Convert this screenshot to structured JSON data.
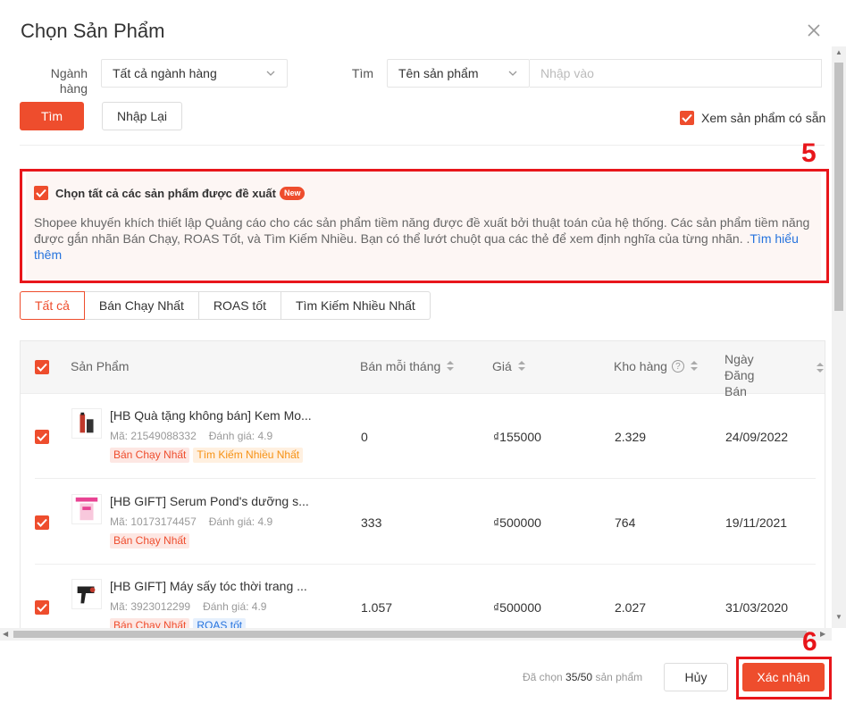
{
  "modal": {
    "title": "Chọn Sản Phẩm"
  },
  "filters": {
    "category_label": "Ngành hàng",
    "category_value": "Tất cả ngành hàng",
    "search_label": "Tìm",
    "search_type_value": "Tên sản phẩm",
    "search_placeholder": "Nhập vào",
    "search_button": "Tìm",
    "reset_button": "Nhập Lại",
    "available_only_label": "Xem sản phẩm có sẵn"
  },
  "suggest": {
    "select_all_label": "Chọn tất cả các sản phẩm được đề xuất",
    "new_badge": "New",
    "description": "Shopee khuyến khích thiết lập Quảng cáo cho các sản phẩm tiềm năng được đề xuất bởi thuật toán của hệ thống. Các sản phẩm tiềm năng được gắn nhãn Bán Chạy, ROAS Tốt, và Tìm Kiếm Nhiều. Bạn có thể lướt chuột qua các thẻ để xem định nghĩa của từng nhãn. Tìm hiểu thêm.",
    "learn_more": "Tìm hiểu thêm"
  },
  "annotations": {
    "step5": "5",
    "step6": "6"
  },
  "tabs": [
    "Tất cả",
    "Bán Chạy Nhất",
    "ROAS tốt",
    "Tìm Kiếm Nhiều Nhất"
  ],
  "table": {
    "headers": {
      "product": "Sản Phẩm",
      "monthly_sales": "Bán mỗi tháng",
      "price": "Giá",
      "stock": "Kho hàng",
      "listed_date": "Ngày Đăng Bán",
      "help_glyph": "?"
    },
    "rows": [
      {
        "name": "[HB Quà tặng không bán] Kem Mo...",
        "code": "Mã: 21549088332",
        "rating": "Đánh giá: 4.9",
        "tags": [
          "Bán Chạy Nhất",
          "Tìm Kiếm Nhiều Nhất"
        ],
        "sales": "0",
        "price": "₫155000",
        "stock": "2.329",
        "date": "24/09/2022"
      },
      {
        "name": "[HB GIFT] Serum Pond's dưỡng s...",
        "code": "Mã: 10173174457",
        "rating": "Đánh giá: 4.9",
        "tags": [
          "Bán Chạy Nhất"
        ],
        "sales": "333",
        "price": "₫500000",
        "stock": "764",
        "date": "19/11/2021"
      },
      {
        "name": "[HB GIFT] Máy sấy tóc thời trang ...",
        "code": "Mã: 3923012299",
        "rating": "Đánh giá: 4.9",
        "tags": [
          "Bán Chạy Nhất",
          "ROAS tốt"
        ],
        "sales": "1.057",
        "price": "₫500000",
        "stock": "2.027",
        "date": "31/03/2020"
      }
    ]
  },
  "footer": {
    "selected_prefix": "Đã chọn",
    "selected_count": "35",
    "selected_total": "/50",
    "selected_suffix": "sản phẩm",
    "cancel_button": "Hủy",
    "confirm_button": "Xác nhận"
  },
  "colors": {
    "primary": "#ee4d2d",
    "annotation_red": "#e8161b",
    "link": "#2673dd"
  }
}
